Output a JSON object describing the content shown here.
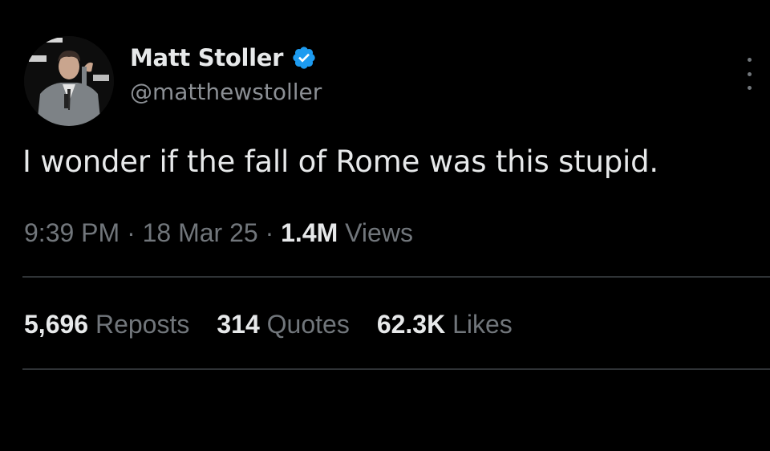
{
  "author": {
    "display_name": "Matt Stoller",
    "handle": "@matthewstoller",
    "verified": true,
    "verified_color": "#1d9bf0"
  },
  "tweet": {
    "text": "I wonder if the fall of Rome was this stupid."
  },
  "meta": {
    "time": "9:39 PM",
    "separator": "·",
    "date": "18 Mar 25",
    "views_count": "1.4M",
    "views_label": "Views"
  },
  "stats": {
    "reposts": {
      "count": "5,696",
      "label": "Reposts"
    },
    "quotes": {
      "count": "314",
      "label": "Quotes"
    },
    "likes": {
      "count": "62.3K",
      "label": "Likes"
    }
  },
  "icons": {
    "verified": "verified-badge-icon",
    "more": "more-options-icon"
  },
  "colors": {
    "background": "#000000",
    "primary_text": "#e7e9ea",
    "secondary_text": "#71767b",
    "divider": "#2f3336"
  }
}
